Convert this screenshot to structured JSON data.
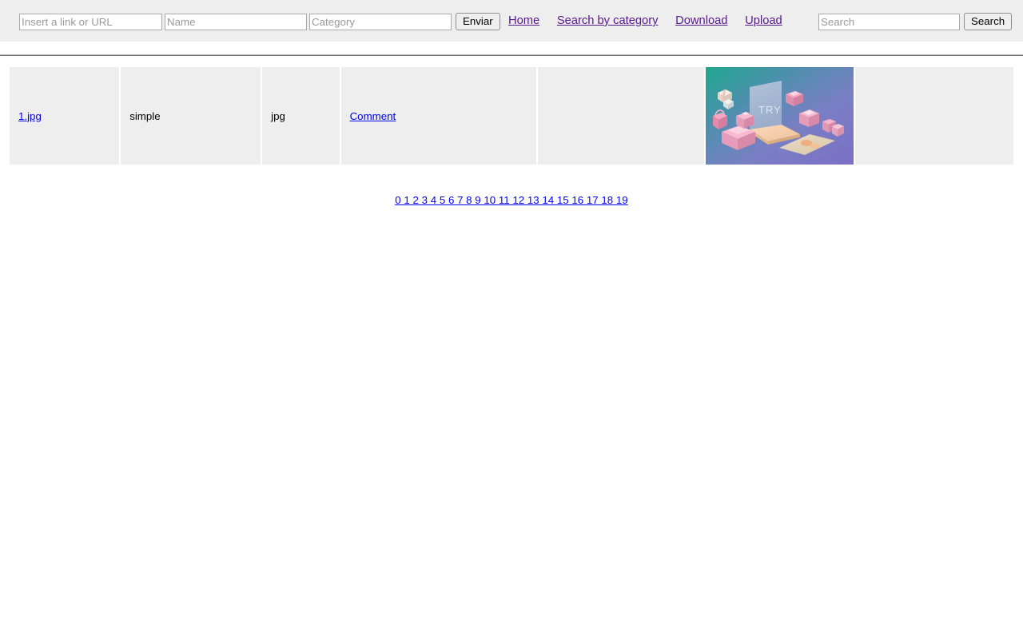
{
  "header": {
    "upload_form": {
      "url_placeholder": "Insert a link or URL",
      "url_value": "",
      "name_placeholder": "Name",
      "name_value": "",
      "category_placeholder": "Category",
      "category_value": "",
      "submit_label": "Enviar"
    },
    "nav": [
      {
        "label": "Home"
      },
      {
        "label": "Search by category"
      },
      {
        "label": "Download"
      },
      {
        "label": "Upload"
      }
    ],
    "search_form": {
      "placeholder": "Search",
      "value": "",
      "button_label": "Search"
    },
    "link_color": "#551a8b"
  },
  "table": {
    "rows": [
      {
        "file_name": "1.jpg",
        "title": "simple",
        "file_type": "jpg",
        "comment_label": "Comment",
        "blank": "",
        "thumb_alt": "3d-isometric-shopping-illustration",
        "tail": ""
      }
    ],
    "cell_bg": "#eeeeee",
    "link_color": "#0000ee"
  },
  "pagination": {
    "pages": [
      "0",
      "1",
      "2",
      "3",
      "4",
      "5",
      "6",
      "7",
      "8",
      "9",
      "10",
      "11",
      "12",
      "13",
      "14",
      "15",
      "16",
      "17",
      "18",
      "19"
    ],
    "link_color": "#0000ee"
  }
}
